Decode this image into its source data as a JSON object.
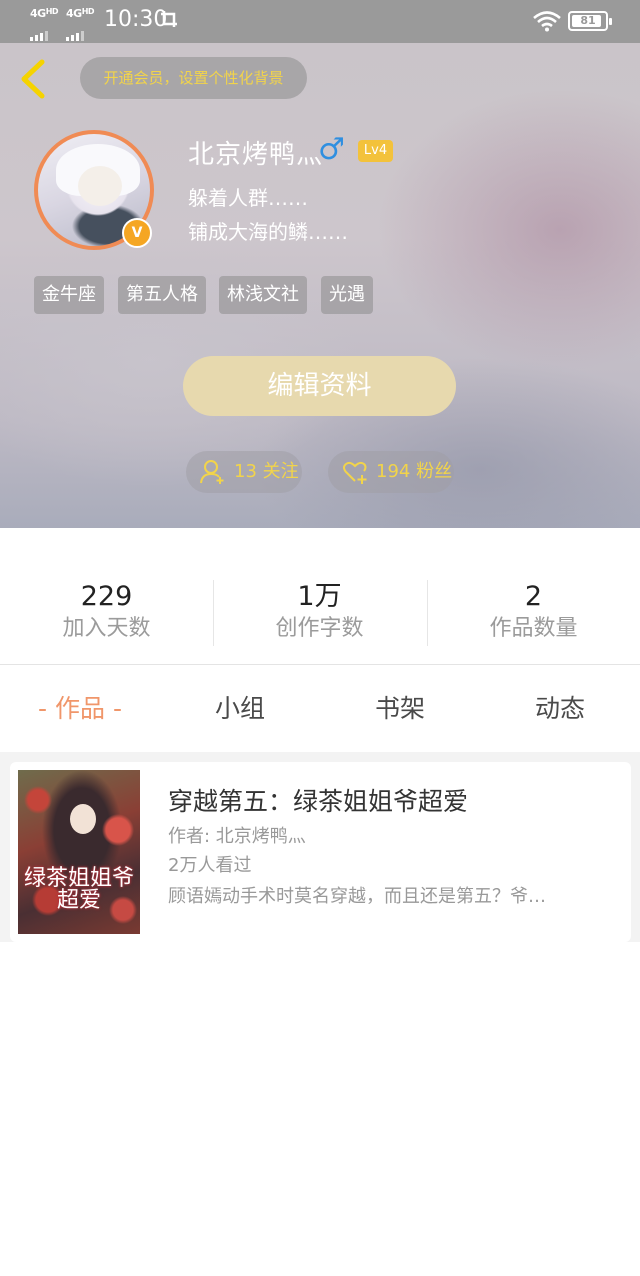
{
  "status_bar": {
    "network_1": "4G",
    "network_1_hd": "HD",
    "network_2": "4G",
    "network_2_hd": "HD",
    "time": "10:30",
    "battery": "81"
  },
  "header": {
    "vip_banner": "开通会员，设置个性化背景",
    "username": "北京烤鸭灬",
    "gender_symbol": "♂",
    "level": "Lv4",
    "verified_badge": "V",
    "bio_lines": [
      "躲着人群……",
      "铺成大海的鳞……"
    ],
    "tags": [
      "金牛座",
      "第五人格",
      "林浅文社",
      "光遇"
    ],
    "edit_button": "编辑资料",
    "following": "13 关注",
    "followers": "194 粉丝",
    "icons": {
      "back": "chevron-left-icon",
      "following": "person-add-icon",
      "followers": "heart-add-icon"
    },
    "colors": {
      "accent_yellow": "#f2d44a",
      "back_arrow": "#f5d300",
      "avatar_border": "#f08b54",
      "edit_button_bg": "#e7d9ae"
    }
  },
  "stats": [
    {
      "value": "229",
      "label": "加入天数"
    },
    {
      "value": "1万",
      "label": "创作字数"
    },
    {
      "value": "2",
      "label": "作品数量"
    }
  ],
  "tabs": [
    {
      "label": "- 作品 -",
      "active": true
    },
    {
      "label": "小组",
      "active": false
    },
    {
      "label": "书架",
      "active": false
    },
    {
      "label": "动态",
      "active": false
    }
  ],
  "works": [
    {
      "title": "穿越第五：绿茶姐姐爷超爱",
      "author": "作者: 北京烤鸭灬",
      "views": "2万人看过",
      "description": "顾语嫣动手术时莫名穿越，而且还是第五？爷…",
      "cover_title": "绿茶姐姐爷超爱"
    }
  ]
}
